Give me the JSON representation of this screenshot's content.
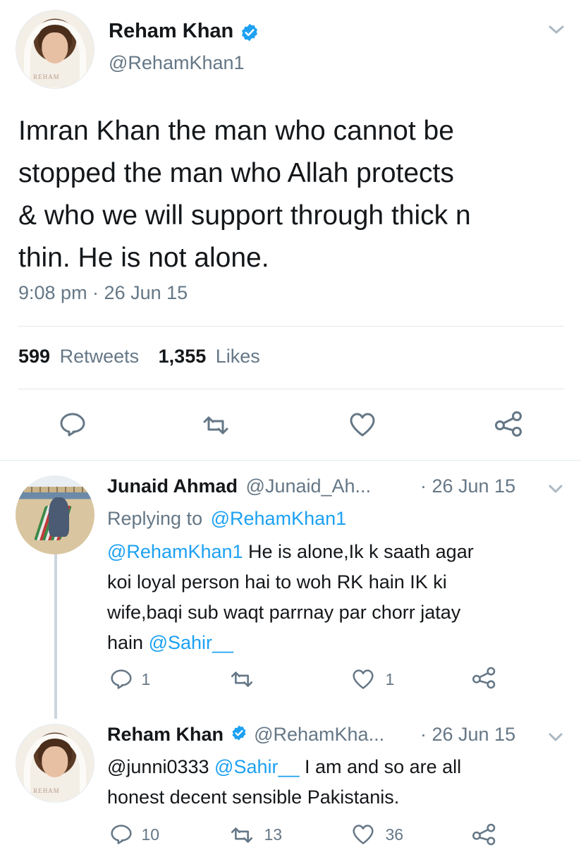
{
  "main_tweet": {
    "author_name": "Reham Khan",
    "handle": "@RehamKhan1",
    "avatar_watermark": "REHAM",
    "text": "Imran Khan the man who cannot be stopped the man who Allah protects & who we will support through thick n thin. He is not alone.",
    "lines": [
      "Imran Khan the man who cannot be",
      "stopped the man who Allah protects",
      "& who we will support through thick n",
      "thin. He is not alone."
    ],
    "timestamp": "9:08 pm · 26 Jun 15",
    "retweet_count": "599",
    "retweet_label": "Retweets",
    "like_count": "1,355",
    "like_label": "Likes"
  },
  "replies": [
    {
      "author_name": "Junaid Ahmad",
      "handle": "@Junaid_Ah...",
      "date": "· 26 Jun 15",
      "replying_prefix": "Replying to",
      "replying_to": "@RehamKhan1",
      "mention_start": "@RehamKhan1",
      "line1_rest": " He is alone,Ik k saath agar",
      "line2": "koi loyal person hai to woh RK hain IK ki",
      "line3": "wife,baqi sub waqt parrnay par chorr jatay",
      "line4_start": "hain ",
      "mention_end": "@Sahir__",
      "reply_count": "1",
      "retweet_count": "",
      "like_count": "1"
    },
    {
      "author_name": "Reham Khan",
      "handle": "@RehamKha...",
      "date": "· 26 Jun 15",
      "avatar_watermark": "REHAM",
      "mention1": "@junni0333",
      "mention2": "@Sahir__",
      "line1_rest": " I am and so are all",
      "line2": "honest decent sensible Pakistanis.",
      "reply_count": "10",
      "retweet_count": "13",
      "like_count": "36"
    }
  ],
  "icons": {
    "reply": "reply-icon",
    "retweet": "retweet-icon",
    "like": "heart-icon",
    "share": "share-icon",
    "more": "chevron-down-icon",
    "verified": "verified-badge-icon"
  },
  "colors": {
    "text": "#14171a",
    "secondary": "#657786",
    "link": "#1da1f2",
    "verified": "#1da1f2",
    "divider": "#e1e8ed"
  }
}
